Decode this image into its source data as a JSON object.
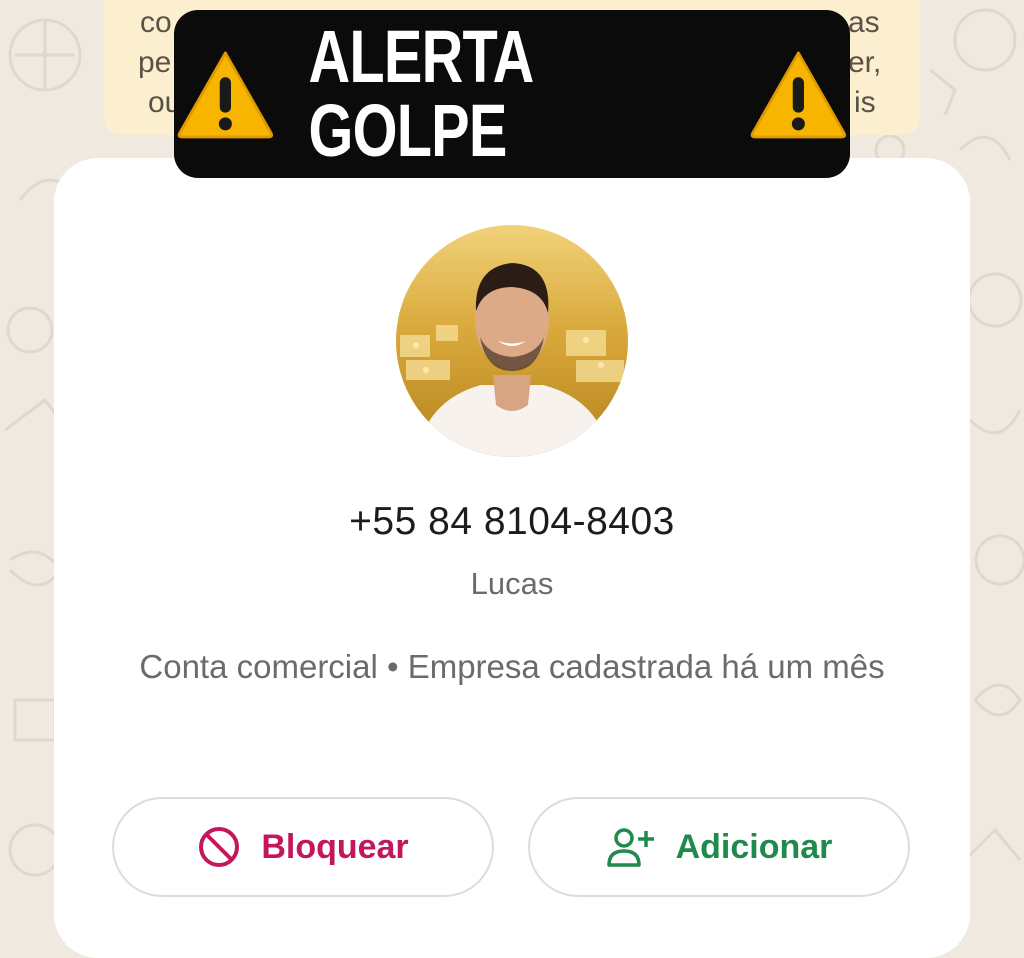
{
  "banner": {
    "text": "ALERTA GOLPE",
    "icon": "warning-icon"
  },
  "notice": {
    "fragments": [
      "co",
      "as",
      "pe",
      "er,",
      "ou",
      "is"
    ]
  },
  "contact": {
    "phone": "+55 84 8104-8403",
    "name": "Lucas",
    "business_info": "Conta comercial • Empresa cadastrada há um mês"
  },
  "actions": {
    "block_label": "Bloquear",
    "add_label": "Adicionar"
  },
  "colors": {
    "alert_bg": "#0b0b0b",
    "block": "#c2185b",
    "add": "#1f8a4c",
    "notice_bg": "#fcefcf",
    "wallpaper": "#efe9e0"
  }
}
